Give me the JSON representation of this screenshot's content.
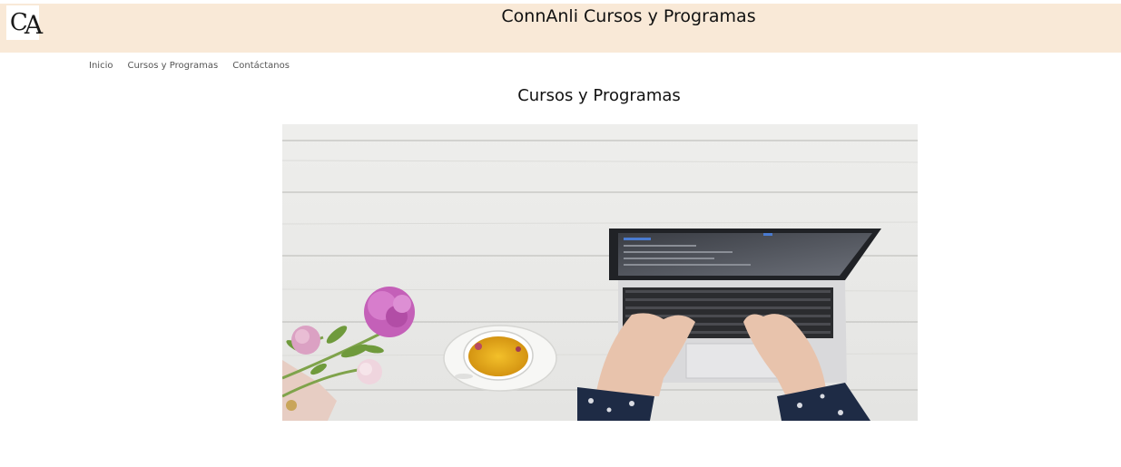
{
  "header": {
    "title": "ConnAnli Cursos y Programas",
    "logo_alt": "CA",
    "background_color": "#f9e9d7"
  },
  "nav": {
    "items": [
      {
        "label": "Inicio"
      },
      {
        "label": "Cursos y Programas"
      },
      {
        "label": "Contáctanos"
      }
    ]
  },
  "main": {
    "heading": "Cursos y Programas",
    "hero_image": "desk-laptop-coffee-flowers-photo"
  }
}
